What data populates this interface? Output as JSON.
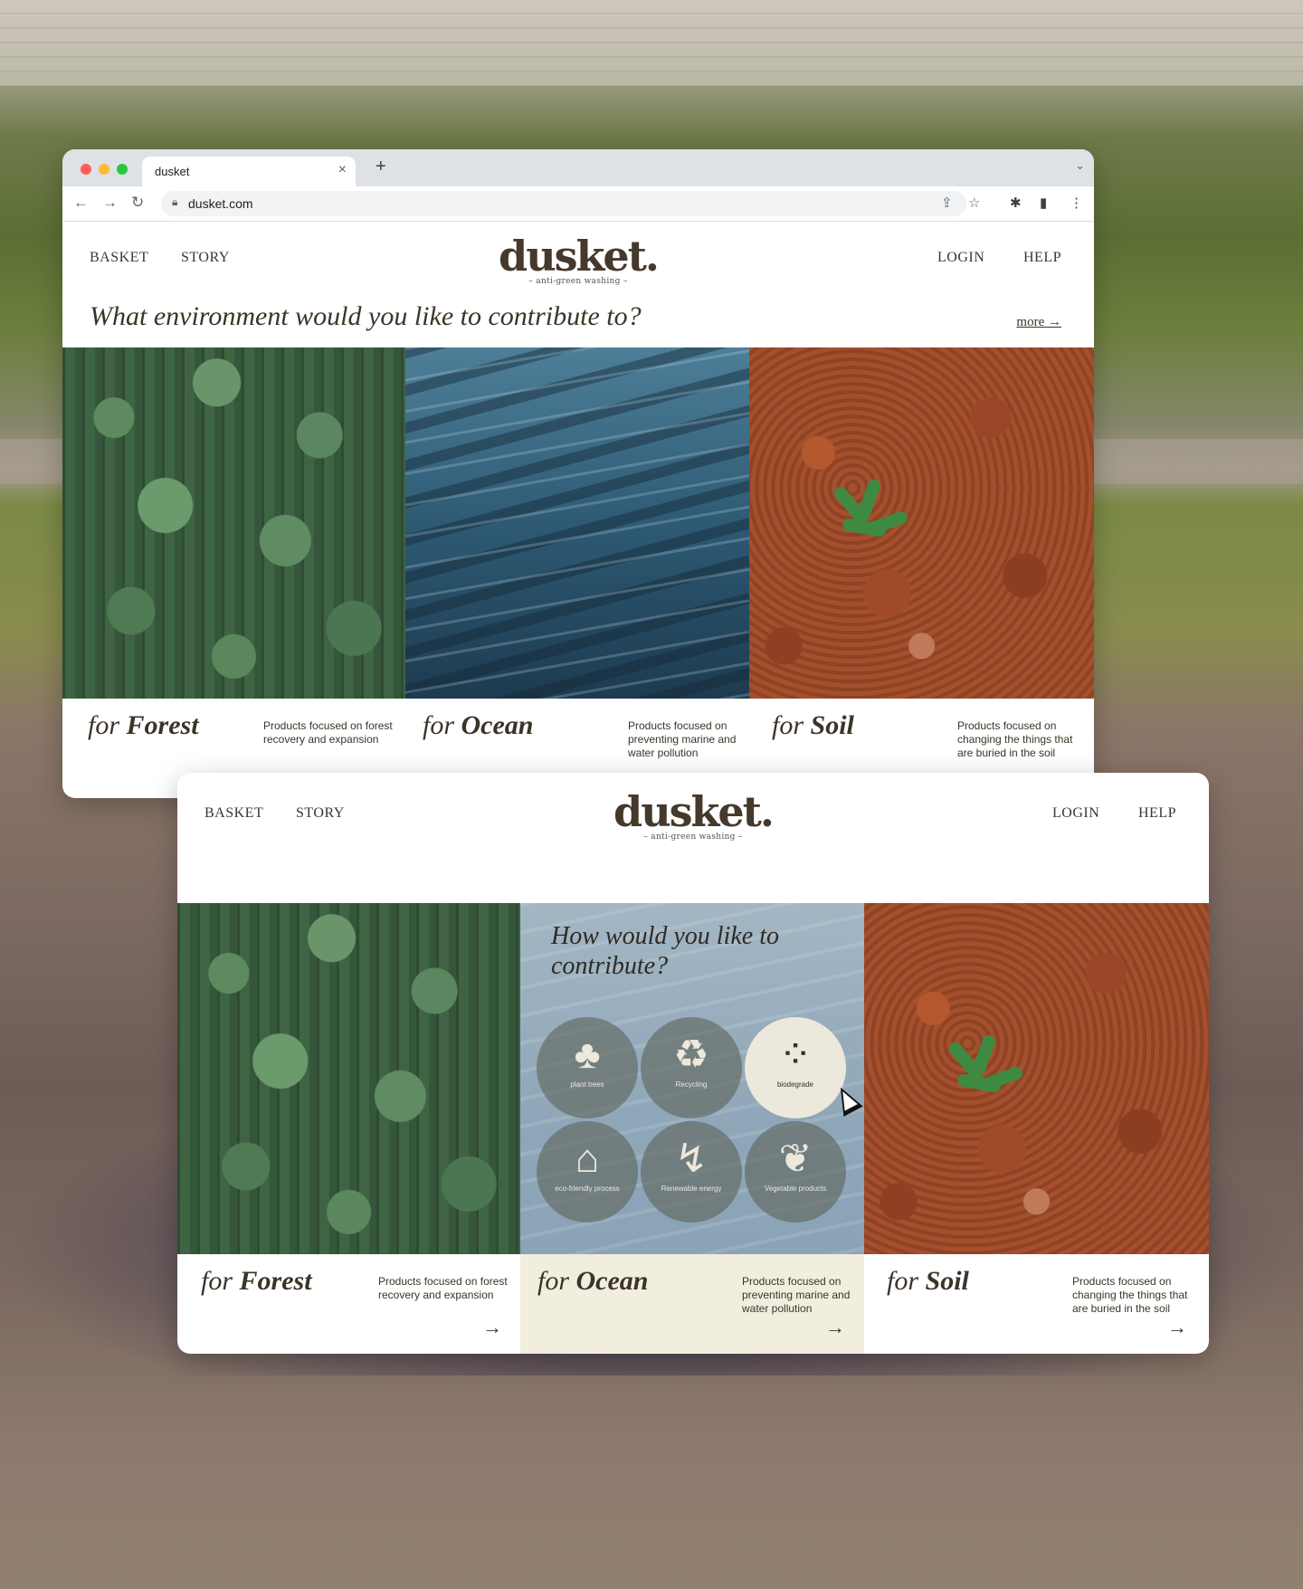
{
  "browser": {
    "tab_title": "dusket",
    "tab_close": "×",
    "new_tab": "+",
    "url": "dusket.com"
  },
  "site": {
    "nav_left": [
      "BASKET",
      "STORY"
    ],
    "nav_right": [
      "LOGIN",
      "HELP"
    ],
    "logo": "dusket.",
    "tagline": "– anti-green washing –"
  },
  "page1": {
    "question": "What environment would you like to contribute to?",
    "more_label": "more →",
    "environments": [
      {
        "for": "for",
        "name": "Forest",
        "desc": "Products focused on forest recovery and expansion"
      },
      {
        "for": "for",
        "name": "Ocean",
        "desc": "Products focused on preventing marine and water pollution"
      },
      {
        "for": "for",
        "name": "Soil",
        "desc": "Products focused on changing the things that are buried in the soil"
      }
    ]
  },
  "page2": {
    "contribute_question": "How would you like to contribute?",
    "options": [
      {
        "label": "plant trees",
        "icon": "plant-trees-icon",
        "active": false
      },
      {
        "label": "Recycling",
        "icon": "recycling-icon",
        "active": false
      },
      {
        "label": "biodegrade",
        "icon": "biodegrade-icon",
        "active": true
      },
      {
        "label": "eco-friendly process",
        "icon": "eco-factory-icon",
        "active": false
      },
      {
        "label": "Renewable energy",
        "icon": "renewable-energy-icon",
        "active": false
      },
      {
        "label": "Vegetable products",
        "icon": "vegetable-products-icon",
        "active": false
      }
    ],
    "arrow": "→"
  }
}
